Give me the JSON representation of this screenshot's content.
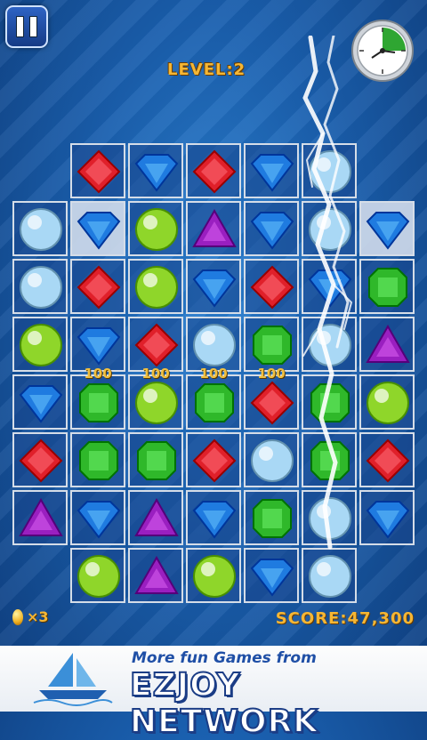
{
  "hud": {
    "level_text": "LEVEL:2",
    "score_text": "SCORE:47,300",
    "gems_remaining_text": "×3",
    "timer_fraction_remaining": 0.25
  },
  "board": {
    "rows": 8,
    "cols": 7,
    "cells": [
      [
        null,
        "red",
        "blue",
        "red",
        "blue",
        "white",
        null
      ],
      [
        "white",
        "blue",
        "green",
        "purple",
        "blue",
        "white",
        "blue"
      ],
      [
        "white",
        "red",
        "green",
        "blue",
        "red",
        "blue",
        "emerald"
      ],
      [
        "green",
        "blue",
        "red",
        "white",
        "emerald",
        "white",
        "purple"
      ],
      [
        "blue",
        "emerald",
        "green",
        "emerald",
        "red",
        "emerald",
        "green"
      ],
      [
        "red",
        "emerald",
        "emerald",
        "red",
        "white",
        "emerald",
        "red"
      ],
      [
        "purple",
        "blue",
        "purple",
        "blue",
        "emerald",
        "white",
        "blue"
      ],
      [
        null,
        "green",
        "purple",
        "green",
        "blue",
        "white",
        null
      ]
    ],
    "selected_cells": [
      [
        1,
        1
      ],
      [
        1,
        6
      ]
    ],
    "point_popups": [
      {
        "row": 4,
        "col": 1,
        "text": "100"
      },
      {
        "row": 4,
        "col": 2,
        "text": "100"
      },
      {
        "row": 4,
        "col": 3,
        "text": "100"
      },
      {
        "row": 4,
        "col": 4,
        "text": "100"
      }
    ]
  },
  "gem_colors": {
    "red": "#e0202a",
    "blue": "#1f7be0",
    "green": "#8fd62a",
    "purple": "#9a1fc0",
    "white": "#a9d8f5",
    "emerald": "#2fb82a"
  },
  "ad": {
    "tagline": "More fun Games from",
    "brand": "EZJOY NETWORK"
  }
}
